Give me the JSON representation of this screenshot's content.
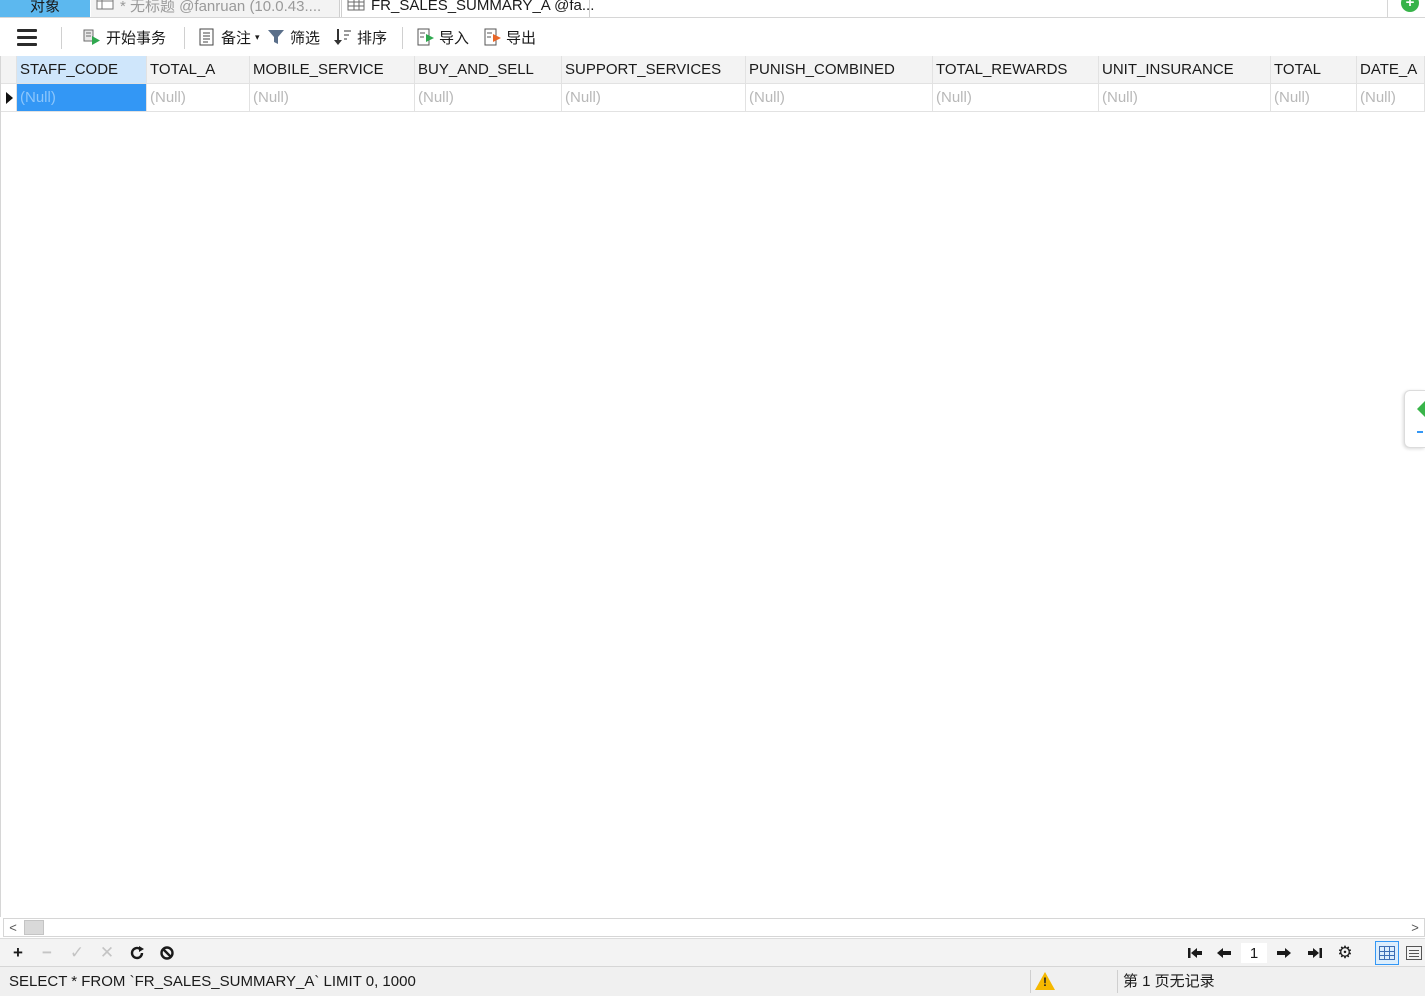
{
  "tabs": {
    "objects": "对象",
    "query": "* 无标题 @fanruan (10.0.43....",
    "table": "FR_SALES_SUMMARY_A @fa..."
  },
  "toolbar": {
    "begin_transaction": "开始事务",
    "memo": "备注",
    "filter": "筛选",
    "sort": "排序",
    "import": "导入",
    "export": "导出"
  },
  "grid": {
    "columns": [
      "STAFF_CODE",
      "TOTAL_A",
      "MOBILE_SERVICE",
      "BUY_AND_SELL",
      "SUPPORT_SERVICES",
      "PUNISH_COMBINED",
      "TOTAL_REWARDS",
      "UNIT_INSURANCE",
      "TOTAL",
      "DATE_A"
    ],
    "rows": [
      [
        "(Null)",
        "(Null)",
        "(Null)",
        "(Null)",
        "(Null)",
        "(Null)",
        "(Null)",
        "(Null)",
        "(Null)",
        "(Null)"
      ]
    ]
  },
  "pager": {
    "page": "1"
  },
  "status": {
    "sql": "SELECT * FROM `FR_SALES_SUMMARY_A` LIMIT 0, 1000",
    "records": "第 1 页无记录"
  },
  "colors": {
    "accent": "#3397f5",
    "objects_tab": "#5cb8ef",
    "active_header": "#cfe6fb",
    "null_text": "#b8b8b8",
    "warning": "#f5b800",
    "add_button": "#37b34a"
  },
  "icons": {
    "menu": "menu-icon",
    "begin_transaction": "transaction-icon",
    "memo": "memo-icon",
    "filter": "filter-icon",
    "sort": "sort-icon",
    "import": "import-icon",
    "export": "export-icon",
    "add_record": "plus-icon",
    "delete_record": "minus-icon",
    "apply": "check-icon",
    "discard": "x-icon",
    "refresh": "refresh-icon",
    "stop": "stop-icon",
    "first_page": "first-page-icon",
    "prev_page": "prev-page-icon",
    "next_page": "next-page-icon",
    "last_page": "last-page-icon",
    "settings": "gear-icon",
    "grid_view": "grid-view-icon",
    "form_view": "form-view-icon",
    "warning": "warning-icon"
  }
}
